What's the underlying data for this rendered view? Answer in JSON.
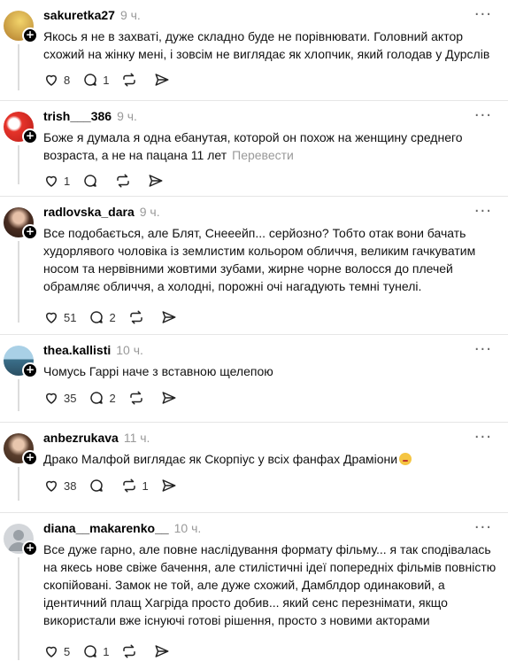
{
  "posts": [
    {
      "username": "sakuretka27",
      "time": "9 ч.",
      "text": "Якось я не в захваті, дуже складно буде не порівнювати. Головний актор схожий на жінку мені, і зовсім не виглядає як хлопчик, який голодав у Дурслів",
      "likes": "8",
      "replies": "1",
      "reposts": "",
      "translate": "",
      "avatar_color": "#e8c14a"
    },
    {
      "username": "trish___386",
      "time": "9 ч.",
      "text": "Боже я думала я одна ебанутая, которой он похож на женщину среднего возраста, а не на пацана 11 лет",
      "likes": "1",
      "replies": "",
      "reposts": "",
      "translate": "Перевести",
      "avatar_color": "#e5332a"
    },
    {
      "username": "radlovska_dara",
      "time": "9 ч.",
      "text": "Все подобається, але Блят, Снееейп... серйозно? Тобто отак вони бачать худорлявого чоловіка із землистим кольором обличчя, великим гачкуватим носом та нервівними жовтими зубами, жирне чорне волосся до плечей обрамляє обличчя, а холодні, порожні очі нагадують темні тунелі.",
      "likes": "51",
      "replies": "2",
      "reposts": "",
      "translate": "",
      "avatar_color": "#8b5e4a"
    },
    {
      "username": "thea.kallisti",
      "time": "10 ч.",
      "text": "Чомусь Гаррі наче з вставною щелепою",
      "likes": "35",
      "replies": "2",
      "reposts": "",
      "translate": "",
      "avatar_color": "#6fa0b8"
    },
    {
      "username": "anbezrukava",
      "time": "11 ч.",
      "text": "Драко Малфой виглядає як Скорпіус у всіх фанфах Драміони",
      "likes": "38",
      "replies": "",
      "reposts": "1",
      "translate": "",
      "avatar_color": "#7a5a44"
    },
    {
      "username": "diana__makarenko__",
      "time": "10 ч.",
      "text": "Все дуже гарно, але повне наслідування формату фільму... я так сподівалась на якесь нове свіже бачення, але стилістичні ідеї попередніх фільмів повністю скопійовані. Замок не той, але дуже схожий, Дамблдор одинаковий, а ідентичний плащ Хагріда просто добив... який сенс перезнімати, якщо використали вже існуючі готові рішення, просто з новими акторами",
      "likes": "5",
      "replies": "1",
      "reposts": "",
      "translate": "",
      "avatar_color": "#c8ccd2"
    }
  ],
  "more_label": "···",
  "plus_label": "+"
}
